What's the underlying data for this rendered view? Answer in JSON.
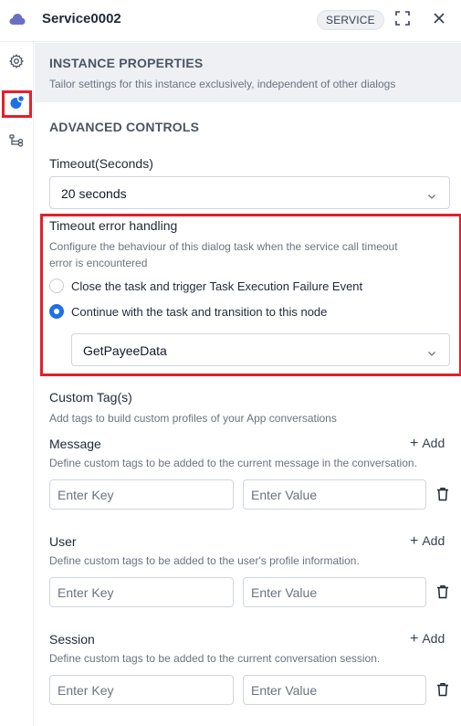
{
  "header": {
    "title": "Service0002",
    "badge": "SERVICE"
  },
  "banner": {
    "title": "INSTANCE PROPERTIES",
    "description": "Tailor settings for this instance exclusively, independent of other dialogs"
  },
  "advanced": {
    "title": "ADVANCED CONTROLS",
    "timeout_label": "Timeout(Seconds)",
    "timeout_value": "20 seconds"
  },
  "error_handling": {
    "title": "Timeout error handling",
    "description_line1": "Configure the behaviour of this dialog task when the service call timeout",
    "description_line2": "error is encountered",
    "options": [
      {
        "label": "Close the task and trigger Task Execution Failure Event",
        "selected": false
      },
      {
        "label": "Continue with the task and transition to this node",
        "selected": true
      }
    ],
    "node_value": "GetPayeeData"
  },
  "custom_tags": {
    "title": "Custom Tag(s)",
    "description": "Add tags to build custom profiles of your App conversations",
    "add_label": "Add",
    "key_placeholder": "Enter Key",
    "value_placeholder": "Enter Value",
    "groups": [
      {
        "name": "Message",
        "description": "Define custom tags to be added to the current message in the conversation."
      },
      {
        "name": "User",
        "description": "Define custom tags to be added to the user's profile information."
      },
      {
        "name": "Session",
        "description": "Define custom tags to be added to the current conversation session."
      }
    ]
  },
  "colors": {
    "accent": "#1f6fe8",
    "highlight": "#e3202b",
    "banner_bg": "#eef0f4"
  },
  "icons": [
    "cloud-icon",
    "expand-icon",
    "close-icon",
    "gear-icon",
    "instance-icon",
    "flow-icon",
    "chevron-down-icon",
    "trash-icon"
  ]
}
